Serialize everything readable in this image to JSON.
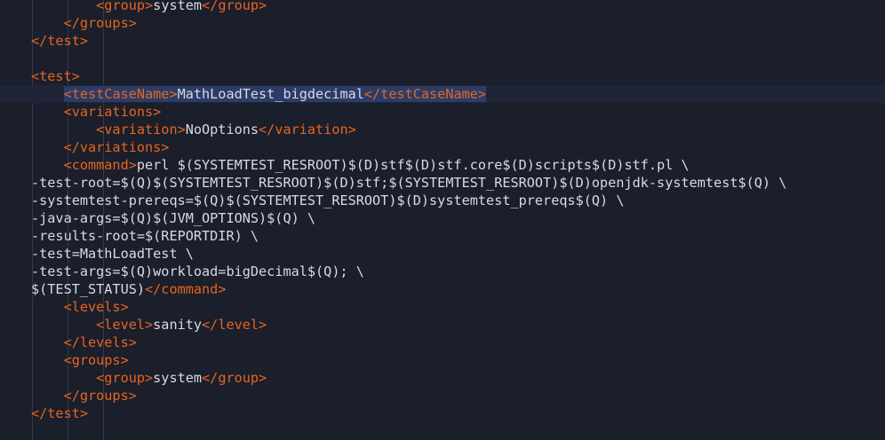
{
  "editor": {
    "lines": [
      [
        [
          "t",
          "        <"
        ],
        [
          "t",
          "group"
        ],
        [
          "t",
          ">"
        ],
        [
          "x",
          "system"
        ],
        [
          "t",
          "</group>"
        ]
      ],
      [
        [
          "t",
          "    </groups>"
        ]
      ],
      [
        [
          "t",
          "</test>"
        ]
      ],
      [],
      [
        [
          "t",
          "<test>"
        ]
      ],
      [
        [
          "t",
          "    <testCaseName>"
        ],
        [
          "x",
          "MathLoadTest_bigdecimal"
        ],
        [
          "t",
          "</testCaseName>"
        ]
      ],
      [
        [
          "t",
          "    <variations>"
        ]
      ],
      [
        [
          "t",
          "        <variation>"
        ],
        [
          "x",
          "NoOptions"
        ],
        [
          "t",
          "</variation>"
        ]
      ],
      [
        [
          "t",
          "    </variations>"
        ]
      ],
      [
        [
          "t",
          "    <command>"
        ],
        [
          "x",
          "perl $(SYSTEMTEST_RESROOT)$(D)stf$(D)stf.core$(D)scripts$(D)stf.pl \\"
        ]
      ],
      [
        [
          "x",
          "-test-root=$(Q)$(SYSTEMTEST_RESROOT)$(D)stf;$(SYSTEMTEST_RESROOT)$(D)openjdk-systemtest$(Q) \\"
        ]
      ],
      [
        [
          "x",
          "-systemtest-prereqs=$(Q)$(SYSTEMTEST_RESROOT)$(D)systemtest_prereqs$(Q) \\"
        ]
      ],
      [
        [
          "x",
          "-java-args=$(Q)$(JVM_OPTIONS)$(Q) \\"
        ]
      ],
      [
        [
          "x",
          "-results-root=$(REPORTDIR) \\"
        ]
      ],
      [
        [
          "x",
          "-test=MathLoadTest \\"
        ]
      ],
      [
        [
          "x",
          "-test-args=$(Q)workload=bigDecimal$(Q); \\"
        ]
      ],
      [
        [
          "x",
          "$(TEST_STATUS)"
        ],
        [
          "t",
          "</command>"
        ]
      ],
      [
        [
          "t",
          "    <levels>"
        ]
      ],
      [
        [
          "t",
          "        <level>"
        ],
        [
          "x",
          "sanity"
        ],
        [
          "t",
          "</level>"
        ]
      ],
      [
        [
          "t",
          "    </levels>"
        ]
      ],
      [
        [
          "t",
          "    <groups>"
        ]
      ],
      [
        [
          "t",
          "        <group>"
        ],
        [
          "x",
          "system"
        ],
        [
          "t",
          "</group>"
        ]
      ],
      [
        [
          "t",
          "    </groups>"
        ]
      ],
      [
        [
          "t",
          "</test>"
        ]
      ]
    ]
  },
  "colors": {
    "background": "#1b1e2b",
    "tag": "#e5661e",
    "text": "#d8dae4",
    "selection": "#2b3c68",
    "current_line": "#1f2436"
  }
}
